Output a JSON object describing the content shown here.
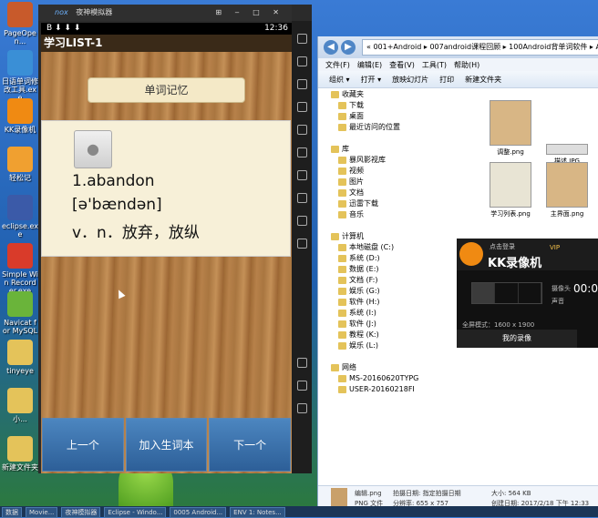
{
  "desktop": {
    "icons": [
      {
        "label": "PageOpen...",
        "color": "#c85a2b"
      },
      {
        "label": "日语单词修改工具.exe",
        "color": "#3a8fd6"
      },
      {
        "label": "KK录像机",
        "color": "#f08a12"
      },
      {
        "label": "轻松记",
        "color": "#f0a030"
      },
      {
        "label": "eclipse.exe",
        "color": "#3b5aa8"
      },
      {
        "label": "Simple Win Recorder.exe",
        "color": "#d93b2a"
      },
      {
        "label": "Navicat for MySQL",
        "color": "#6ab43a"
      },
      {
        "label": "tinyeye",
        "color": "#e4c35a"
      },
      {
        "label": "小...",
        "color": "#e4c35a"
      },
      {
        "label": "新建文件夹",
        "color": "#e4c35a"
      }
    ]
  },
  "emulator": {
    "title": "夜神模拟器",
    "brand": "nox",
    "status_time": "12:36",
    "app_title": "学习LIST-1",
    "tab_label": "单词记忆",
    "word": "1.abandon",
    "phonetic": "[ə'bændən]",
    "meaning": "v．n．放弃，放纵",
    "buttons": {
      "prev": "上一个",
      "add": "加入生词本",
      "next": "下一个"
    }
  },
  "explorer": {
    "address": "« 001+Android ▸ 007android课程回顾 ▸ 100Android背单词软件 ▸ Android",
    "menu": [
      "文件(F)",
      "编辑(E)",
      "查看(V)",
      "工具(T)",
      "帮助(H)"
    ],
    "toolbar": [
      "组织 ▾",
      "打开 ▾",
      "放映幻灯片",
      "打印",
      "新建文件夹"
    ],
    "tree": [
      "收藏夹",
      "下载",
      "桌面",
      "最近访问的位置",
      "",
      "库",
      "暴风影视库",
      "视频",
      "图片",
      "文档",
      "迅雷下载",
      "音乐",
      "",
      "计算机",
      "本地磁盘 (C:)",
      "系统 (D:)",
      "数据 (E:)",
      "文档 (F:)",
      "娱乐 (G:)",
      "软件 (H:)",
      "系统 (I:)",
      "软件 (J:)",
      "教程 (K:)",
      "娱乐 (L:)",
      "",
      "网络",
      "MS-20160620TYPG",
      "USER-20160218FI"
    ],
    "thumbs": [
      "调整.png",
      "描述.JPG",
      "学习列表.png",
      "主界面.png"
    ],
    "status": {
      "filename": "编辑.png",
      "type": "PNG 文件",
      "taken": "拍摄日期: 指定拍摄日期",
      "dims": "分辨率: 655 x 757",
      "size": "大小: 564 KB",
      "created": "创建日期: 2017/2/18 下午 12:33"
    }
  },
  "kk": {
    "title": "KK录像机",
    "login": "点击登录",
    "vip": "VIP",
    "mode": "全屏模式：1600 x 1900",
    "label1": "摄像头",
    "label2": "声音",
    "timer": "00:0",
    "footer": "我的录像"
  },
  "taskbar": [
    "数据",
    "Movie...",
    "夜神模拟器",
    "Eclipse - Windo...",
    "0005 Android...",
    "ENV 1: Notes..."
  ]
}
